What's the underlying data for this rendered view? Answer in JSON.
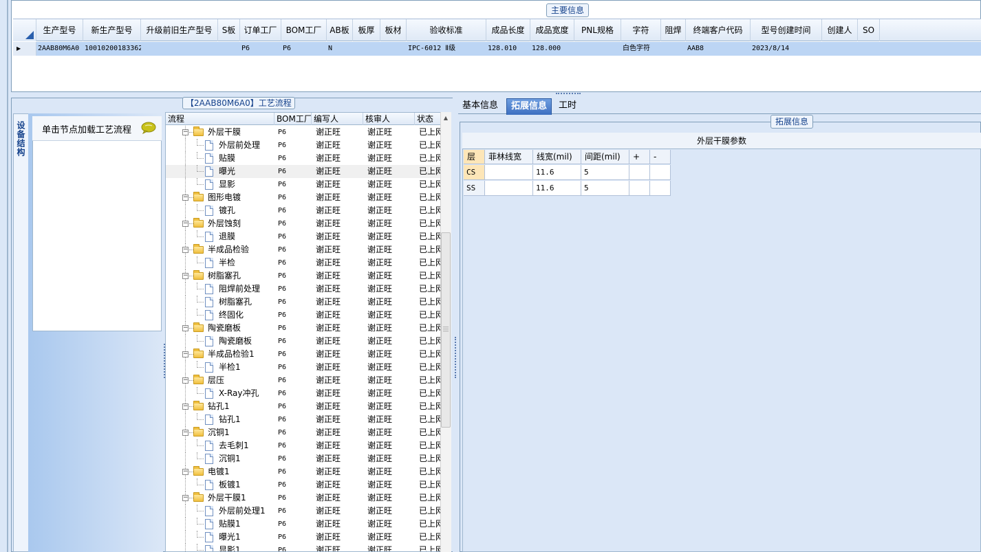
{
  "main_info": {
    "legend": "主要信息",
    "columns": [
      "生产型号",
      "新生产型号",
      "升级前旧生产型号",
      "S板",
      "订单工厂",
      "BOM工厂",
      "AB板",
      "板厚",
      "板材",
      "验收标准",
      "成品长度",
      "成品宽度",
      "PNL规格",
      "字符",
      "阻焊",
      "终端客户代码",
      "型号创建时间",
      "创建人",
      "SO"
    ],
    "row": {
      "生产型号": "2AAB80M6A0",
      "新生产型号": "10010200183362",
      "升级前旧生产型号": "",
      "S板": "",
      "订单工厂": "P6",
      "BOM工厂": "P6",
      "AB板": "N",
      "板厚": "",
      "板材": "",
      "验收标准": "IPC-6012 Ⅱ级",
      "成品长度": "128.010",
      "成品宽度": "128.000",
      "PNL规格": "",
      "字符": "白色字符",
      "阻焊": "",
      "终端客户代码": "AAB8",
      "型号创建时间": "2023/8/14",
      "创建人": "",
      "SO": ""
    },
    "row_selector": "▶"
  },
  "left_panel": {
    "side_tab_label": "设备结构",
    "node_hint": "单击节点加载工艺流程",
    "bubble_icon": "speech-bubble-icon"
  },
  "process_tree": {
    "legend": "【2AAB80M6A0】工艺流程",
    "columns": [
      "流程",
      "BOM工厂",
      "编写人",
      "核审人",
      "状态"
    ],
    "rows": [
      {
        "level": 0,
        "name": "外层干膜",
        "bom": "P6",
        "writer": "谢正旺",
        "reviewer": "谢正旺",
        "status": "已上网"
      },
      {
        "level": 1,
        "name": "外层前处理",
        "bom": "P6",
        "writer": "谢正旺",
        "reviewer": "谢正旺",
        "status": "已上网"
      },
      {
        "level": 1,
        "name": "贴膜",
        "bom": "P6",
        "writer": "谢正旺",
        "reviewer": "谢正旺",
        "status": "已上网"
      },
      {
        "level": 1,
        "name": "曝光",
        "bom": "P6",
        "writer": "谢正旺",
        "reviewer": "谢正旺",
        "status": "已上网",
        "selected": true
      },
      {
        "level": 1,
        "name": "显影",
        "bom": "P6",
        "writer": "谢正旺",
        "reviewer": "谢正旺",
        "status": "已上网"
      },
      {
        "level": 0,
        "name": "图形电镀",
        "bom": "P6",
        "writer": "谢正旺",
        "reviewer": "谢正旺",
        "status": "已上网"
      },
      {
        "level": 1,
        "name": "镀孔",
        "bom": "P6",
        "writer": "谢正旺",
        "reviewer": "谢正旺",
        "status": "已上网"
      },
      {
        "level": 0,
        "name": "外层蚀刻",
        "bom": "P6",
        "writer": "谢正旺",
        "reviewer": "谢正旺",
        "status": "已上网"
      },
      {
        "level": 1,
        "name": "退膜",
        "bom": "P6",
        "writer": "谢正旺",
        "reviewer": "谢正旺",
        "status": "已上网"
      },
      {
        "level": 0,
        "name": "半成品检验",
        "bom": "P6",
        "writer": "谢正旺",
        "reviewer": "谢正旺",
        "status": "已上网"
      },
      {
        "level": 1,
        "name": "半检",
        "bom": "P6",
        "writer": "谢正旺",
        "reviewer": "谢正旺",
        "status": "已上网"
      },
      {
        "level": 0,
        "name": "树脂塞孔",
        "bom": "P6",
        "writer": "谢正旺",
        "reviewer": "谢正旺",
        "status": "已上网"
      },
      {
        "level": 1,
        "name": "阻焊前处理",
        "bom": "P6",
        "writer": "谢正旺",
        "reviewer": "谢正旺",
        "status": "已上网"
      },
      {
        "level": 1,
        "name": "树脂塞孔",
        "bom": "P6",
        "writer": "谢正旺",
        "reviewer": "谢正旺",
        "status": "已上网"
      },
      {
        "level": 1,
        "name": "终固化",
        "bom": "P6",
        "writer": "谢正旺",
        "reviewer": "谢正旺",
        "status": "已上网"
      },
      {
        "level": 0,
        "name": "陶瓷磨板",
        "bom": "P6",
        "writer": "谢正旺",
        "reviewer": "谢正旺",
        "status": "已上网"
      },
      {
        "level": 1,
        "name": "陶瓷磨板",
        "bom": "P6",
        "writer": "谢正旺",
        "reviewer": "谢正旺",
        "status": "已上网"
      },
      {
        "level": 0,
        "name": "半成品检验1",
        "bom": "P6",
        "writer": "谢正旺",
        "reviewer": "谢正旺",
        "status": "已上网"
      },
      {
        "level": 1,
        "name": "半检1",
        "bom": "P6",
        "writer": "谢正旺",
        "reviewer": "谢正旺",
        "status": "已上网"
      },
      {
        "level": 0,
        "name": "层压",
        "bom": "P6",
        "writer": "谢正旺",
        "reviewer": "谢正旺",
        "status": "已上网"
      },
      {
        "level": 1,
        "name": "X-Ray冲孔",
        "bom": "P6",
        "writer": "谢正旺",
        "reviewer": "谢正旺",
        "status": "已上网"
      },
      {
        "level": 0,
        "name": "钻孔1",
        "bom": "P6",
        "writer": "谢正旺",
        "reviewer": "谢正旺",
        "status": "已上网"
      },
      {
        "level": 1,
        "name": "钻孔1",
        "bom": "P6",
        "writer": "谢正旺",
        "reviewer": "谢正旺",
        "status": "已上网"
      },
      {
        "level": 0,
        "name": "沉铜1",
        "bom": "P6",
        "writer": "谢正旺",
        "reviewer": "谢正旺",
        "status": "已上网"
      },
      {
        "level": 1,
        "name": "去毛刺1",
        "bom": "P6",
        "writer": "谢正旺",
        "reviewer": "谢正旺",
        "status": "已上网"
      },
      {
        "level": 1,
        "name": "沉铜1",
        "bom": "P6",
        "writer": "谢正旺",
        "reviewer": "谢正旺",
        "status": "已上网"
      },
      {
        "level": 0,
        "name": "电镀1",
        "bom": "P6",
        "writer": "谢正旺",
        "reviewer": "谢正旺",
        "status": "已上网"
      },
      {
        "level": 1,
        "name": "板镀1",
        "bom": "P6",
        "writer": "谢正旺",
        "reviewer": "谢正旺",
        "status": "已上网"
      },
      {
        "level": 0,
        "name": "外层干膜1",
        "bom": "P6",
        "writer": "谢正旺",
        "reviewer": "谢正旺",
        "status": "已上网"
      },
      {
        "level": 1,
        "name": "外层前处理1",
        "bom": "P6",
        "writer": "谢正旺",
        "reviewer": "谢正旺",
        "status": "已上网"
      },
      {
        "level": 1,
        "name": "贴膜1",
        "bom": "P6",
        "writer": "谢正旺",
        "reviewer": "谢正旺",
        "status": "已上网"
      },
      {
        "level": 1,
        "name": "曝光1",
        "bom": "P6",
        "writer": "谢正旺",
        "reviewer": "谢正旺",
        "status": "已上网"
      },
      {
        "level": 1,
        "name": "显影1",
        "bom": "P6",
        "writer": "谢正旺",
        "reviewer": "谢正旺",
        "status": "已上网"
      }
    ]
  },
  "right_panel": {
    "tabs": [
      {
        "label": "基本信息",
        "active": false
      },
      {
        "label": "拓展信息",
        "active": true
      },
      {
        "label": "工时",
        "active": false
      }
    ],
    "legend": "拓展信息",
    "table_title": "外层干膜参数",
    "columns": [
      "层",
      "菲林线宽",
      "线宽(mil)",
      "间距(mil)",
      "+",
      "-"
    ],
    "rows": [
      {
        "layer": "CS",
        "film_width": "",
        "width": "11.6",
        "spacing": "5"
      },
      {
        "layer": "SS",
        "film_width": "",
        "width": "11.6",
        "spacing": "5"
      }
    ]
  }
}
